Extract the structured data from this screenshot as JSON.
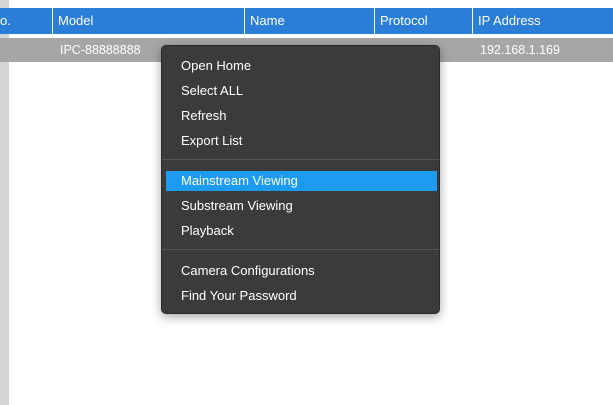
{
  "table": {
    "columns": [
      "o.",
      "Model",
      "Name",
      "Protocol",
      "IP Address"
    ],
    "rows": [
      {
        "no": "",
        "model": "IPC-88888888",
        "name": "",
        "protocol": "",
        "ip_address": "192.168.1.169"
      }
    ]
  },
  "context_menu": {
    "groups": [
      [
        "Open Home",
        "Select ALL",
        "Refresh",
        "Export List"
      ],
      [
        "Mainstream Viewing",
        "Substream Viewing",
        "Playback"
      ],
      [
        "Camera Configurations",
        "Find Your Password"
      ]
    ],
    "highlighted_item": "Mainstream Viewing"
  },
  "colors": {
    "header_bg": "#2b7ed8",
    "selected_row_bg": "#a6a6a6",
    "menu_bg": "#3b3b3b",
    "menu_highlight": "#1d9bf0"
  }
}
